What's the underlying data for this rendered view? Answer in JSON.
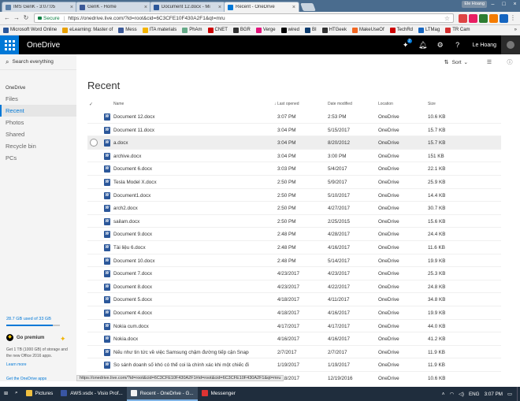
{
  "browser": {
    "profile": "Ele Hoang",
    "tabs": [
      {
        "label": "IMS GenK - 3:07:05",
        "color": "#5a7fa8"
      },
      {
        "label": "GenK - Home",
        "color": "#3b5998"
      },
      {
        "label": "Document 12.docx - Mi",
        "color": "#2b579a"
      },
      {
        "label": "Recent - OneDrive",
        "color": "#0078d7"
      }
    ],
    "secure_label": "Secure",
    "url": "https://onedrive.live.com/?id=root&cid=6C3CFE10F430A2F1&qt=mru",
    "bookmarks": [
      {
        "label": "Microsoft Word Online",
        "color": "#2b579a"
      },
      {
        "label": "eLearning: Master of",
        "color": "#e8a000"
      },
      {
        "label": "Mess",
        "color": "#3b5998"
      },
      {
        "label": "ITA materials",
        "color": "#f4b400"
      },
      {
        "label": "PhAm",
        "color": "#6a8"
      },
      {
        "label": "CNET",
        "color": "#c00"
      },
      {
        "label": "BGR",
        "color": "#333"
      },
      {
        "label": "Verge",
        "color": "#e2127a"
      },
      {
        "label": "wired",
        "color": "#000"
      },
      {
        "label": "BI",
        "color": "#0b3b6e"
      },
      {
        "label": "HTGeek",
        "color": "#333"
      },
      {
        "label": "MakeUseOf",
        "color": "#f26722"
      },
      {
        "label": "TechRd",
        "color": "#c00"
      },
      {
        "label": "LTMag",
        "color": "#1565c0"
      },
      {
        "label": "TR Cam",
        "color": "#d32f2f"
      }
    ],
    "bookmarks_more": "»",
    "status_url": "https://onedrive.live.com/?id=root&cid=6C3CFE10F430A2F1#id=root&cid=6C3CFE10F430A2F1&qt=mru"
  },
  "header": {
    "brand": "OneDrive",
    "notification_count": "2",
    "user_name": "Le Hoang"
  },
  "sidebar": {
    "search_placeholder": "Search everything",
    "section_label": "OneDrive",
    "items": [
      "Files",
      "Recent",
      "Photos",
      "Shared",
      "Recycle bin",
      "PCs"
    ],
    "active_index": 1,
    "storage_text": "28.7 GB used of 33 GB",
    "storage_fraction": 0.87,
    "premium_title": "Go premium",
    "premium_text": "Get 1 TB (1000 GB) of storage and the new Office 2016 apps.",
    "learn_more": "Learn more",
    "get_apps": "Get the OneDrive apps"
  },
  "main": {
    "sort_label": "Sort",
    "title": "Recent",
    "columns": {
      "name": "Name",
      "last_opened": "Last opened",
      "date_modified": "Date modified",
      "location": "Location",
      "size": "Size"
    },
    "highlight_index": 2,
    "files": [
      {
        "name": "Document 12.docx",
        "last_opened": "3:07 PM",
        "modified": "2:53 PM",
        "location": "OneDrive",
        "size": "10.6 KB"
      },
      {
        "name": "Document 11.docx",
        "last_opened": "3:04 PM",
        "modified": "5/15/2017",
        "location": "OneDrive",
        "size": "15.7 KB"
      },
      {
        "name": "a.docx",
        "last_opened": "3:04 PM",
        "modified": "8/20/2012",
        "location": "OneDrive",
        "size": "15.7 KB"
      },
      {
        "name": "archive.docx",
        "last_opened": "3:04 PM",
        "modified": "3:00 PM",
        "location": "OneDrive",
        "size": "151 KB"
      },
      {
        "name": "Document 6.docx",
        "last_opened": "3:03 PM",
        "modified": "5/4/2017",
        "location": "OneDrive",
        "size": "22.1 KB"
      },
      {
        "name": "Tesla Model X.docx",
        "last_opened": "2:50 PM",
        "modified": "5/9/2017",
        "location": "OneDrive",
        "size": "25.9 KB"
      },
      {
        "name": "Document1.docx",
        "last_opened": "2:50 PM",
        "modified": "5/10/2017",
        "location": "OneDrive",
        "size": "14.4 KB"
      },
      {
        "name": "arch2.docx",
        "last_opened": "2:50 PM",
        "modified": "4/27/2017",
        "location": "OneDrive",
        "size": "30.7 KB"
      },
      {
        "name": "sailam.docx",
        "last_opened": "2:50 PM",
        "modified": "2/25/2015",
        "location": "OneDrive",
        "size": "15.6 KB"
      },
      {
        "name": "Document 9.docx",
        "last_opened": "2:48 PM",
        "modified": "4/28/2017",
        "location": "OneDrive",
        "size": "24.4 KB"
      },
      {
        "name": "Tài liệu 6.docx",
        "last_opened": "2:48 PM",
        "modified": "4/16/2017",
        "location": "OneDrive",
        "size": "11.6 KB"
      },
      {
        "name": "Document 10.docx",
        "last_opened": "2:48 PM",
        "modified": "5/14/2017",
        "location": "OneDrive",
        "size": "19.9 KB"
      },
      {
        "name": "Document 7.docx",
        "last_opened": "4/23/2017",
        "modified": "4/23/2017",
        "location": "OneDrive",
        "size": "25.3 KB"
      },
      {
        "name": "Document 8.docx",
        "last_opened": "4/23/2017",
        "modified": "4/22/2017",
        "location": "OneDrive",
        "size": "24.8 KB"
      },
      {
        "name": "Document 5.docx",
        "last_opened": "4/18/2017",
        "modified": "4/11/2017",
        "location": "OneDrive",
        "size": "34.8 KB"
      },
      {
        "name": "Document 4.docx",
        "last_opened": "4/18/2017",
        "modified": "4/16/2017",
        "location": "OneDrive",
        "size": "19.9 KB"
      },
      {
        "name": "Nokia cum.docx",
        "last_opened": "4/17/2017",
        "modified": "4/17/2017",
        "location": "OneDrive",
        "size": "44.0 KB"
      },
      {
        "name": "Nokia.docx",
        "last_opened": "4/16/2017",
        "modified": "4/16/2017",
        "location": "OneDrive",
        "size": "41.2 KB"
      },
      {
        "name": "Nếu như tin tức về việc Samsung chậm đường tiếp cận Snapdragon 83...",
        "last_opened": "2/7/2017",
        "modified": "2/7/2017",
        "location": "OneDrive",
        "size": "11.9 KB"
      },
      {
        "name": "So sánh doanh số khó có thể coi là chính xác khi một chiếc điện thoại ...",
        "last_opened": "1/19/2017",
        "modified": "1/19/2017",
        "location": "OneDrive",
        "size": "11.9 KB"
      },
      {
        "name": "Rất nhiều tin hiệu cho thấy smartphone sẽ sớm để mắt vị trí là thiết bị...",
        "last_opened": "1/18/2017",
        "modified": "12/19/2016",
        "location": "OneDrive",
        "size": "10.6 KB"
      }
    ]
  },
  "taskbar": {
    "apps": [
      {
        "label": "Pictures",
        "color": "#f0c040"
      },
      {
        "label": "AWS.vsdx - Visio Prof...",
        "color": "#3955a3"
      },
      {
        "label": "Recent - OneDrive - G...",
        "color": "#f2f2f2",
        "active": true
      },
      {
        "label": "Messenger",
        "color": "#d33"
      }
    ],
    "lang": "ENG",
    "time": "3:07 PM"
  }
}
